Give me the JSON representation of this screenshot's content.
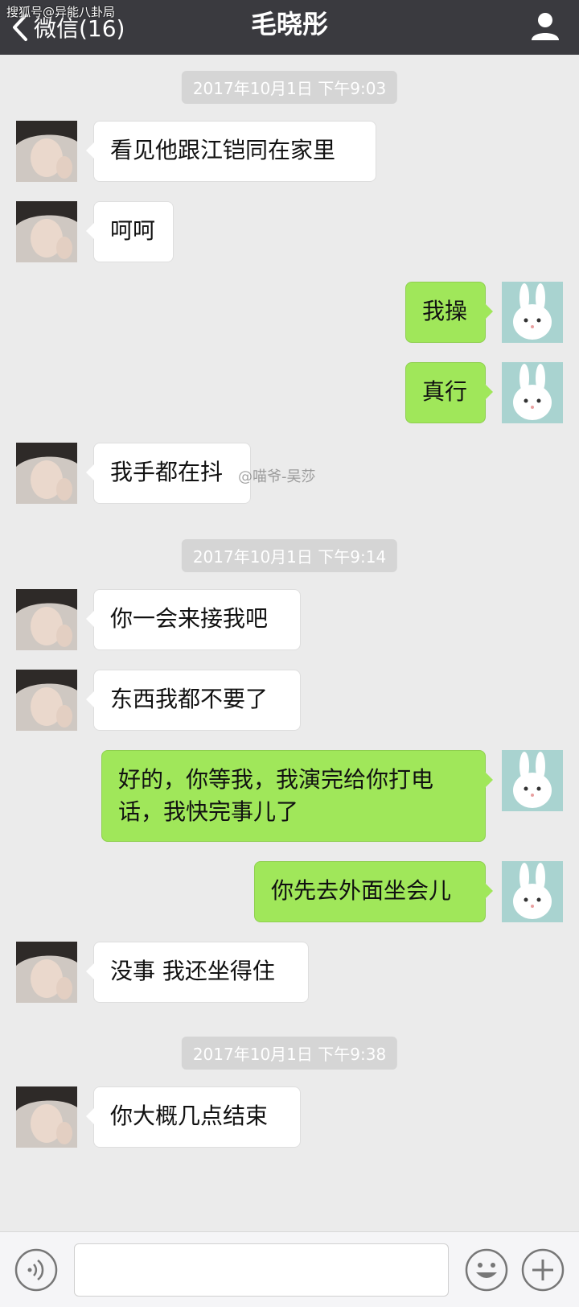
{
  "navbar": {
    "back_label": "微信(16)",
    "title": "毛晓彤"
  },
  "watermarks": {
    "top_left": "搜狐号@异能八卦局",
    "weibo": "@喵爷-吴莎"
  },
  "colors": {
    "navbar_bg": "#3a3a3f",
    "chat_bg": "#ebebeb",
    "outgoing_bubble": "#a0e75a",
    "incoming_bubble": "#ffffff"
  },
  "messages": [
    {
      "type": "timestamp",
      "text": "2017年10月1日 下午9:03"
    },
    {
      "type": "incoming",
      "text": "看见他跟江铠同在家里"
    },
    {
      "type": "incoming",
      "text": "呵呵"
    },
    {
      "type": "outgoing",
      "text": "我操"
    },
    {
      "type": "outgoing",
      "text": "真行"
    },
    {
      "type": "incoming",
      "text": "我手都在抖"
    },
    {
      "type": "timestamp",
      "text": "2017年10月1日 下午9:14"
    },
    {
      "type": "incoming",
      "text": "你一会来接我吧"
    },
    {
      "type": "incoming",
      "text": "东西我都不要了"
    },
    {
      "type": "outgoing",
      "text": "好的，你等我，我演完给你打电话，我快完事儿了"
    },
    {
      "type": "outgoing",
      "text": "你先去外面坐会儿"
    },
    {
      "type": "incoming",
      "text": "没事 我还坐得住"
    },
    {
      "type": "timestamp",
      "text": "2017年10月1日 下午9:38"
    },
    {
      "type": "incoming",
      "text": "你大概几点结束"
    }
  ],
  "input": {
    "placeholder": "",
    "icons": [
      "voice-icon",
      "emoji-icon",
      "plus-icon"
    ]
  }
}
